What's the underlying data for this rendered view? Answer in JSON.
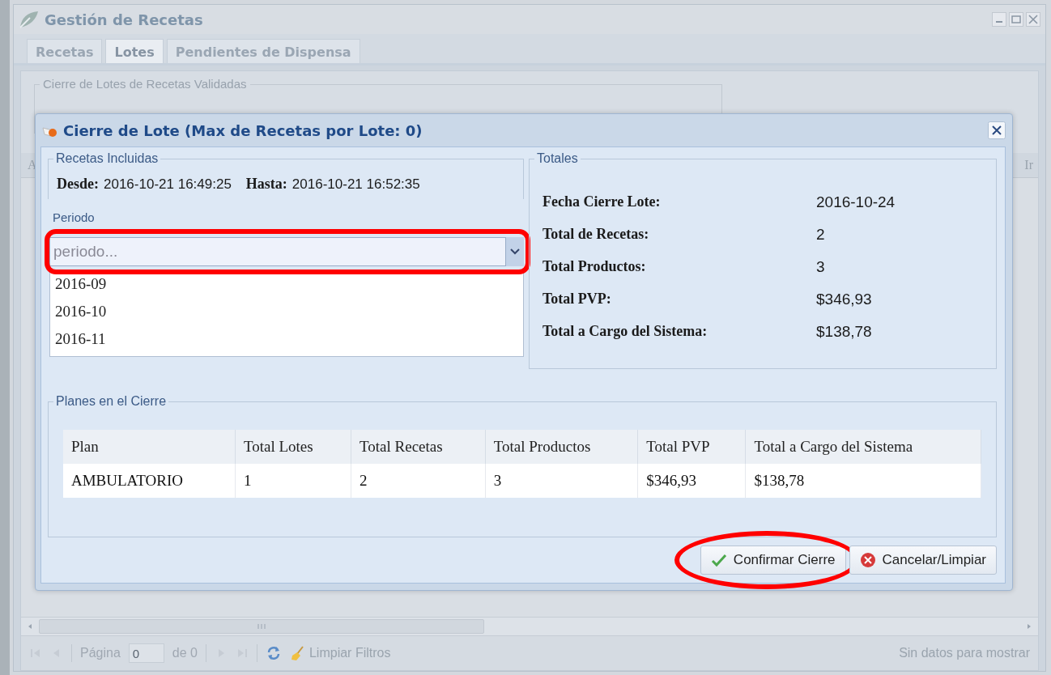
{
  "window": {
    "title": "Gestión de Recetas"
  },
  "tabs": [
    {
      "label": "Recetas",
      "selected": false
    },
    {
      "label": "Lotes",
      "selected": true
    },
    {
      "label": "Pendientes de Dispensa",
      "selected": false
    }
  ],
  "panel": {
    "legend": "Cierre de Lotes de Recetas Validadas"
  },
  "grid": {
    "columns": [
      "A",
      "Ir"
    ]
  },
  "dialog": {
    "title": "Cierre de Lote (Max de Recetas por Lote: 0)",
    "included": {
      "legend": "Recetas Incluidas",
      "fields": [
        {
          "label": "Desde:",
          "value": "2016-10-21 16:49:25"
        },
        {
          "label": "Hasta:",
          "value": "2016-10-21 16:52:35"
        }
      ]
    },
    "period": {
      "label": "Periodo",
      "placeholder": "periodo...",
      "expanded": true,
      "highlighted": true,
      "options": [
        "2016-09",
        "2016-10",
        "2016-11"
      ]
    },
    "totals": {
      "legend": "Totales",
      "rows": [
        {
          "label": "Fecha Cierre Lote:",
          "value": "2016-10-24"
        },
        {
          "label": "Total de Recetas:",
          "value": "2"
        },
        {
          "label": "Total Productos:",
          "value": "3"
        },
        {
          "label": "Total PVP:",
          "value": "$346,93"
        },
        {
          "label": "Total a Cargo del Sistema:",
          "value": "$138,78"
        }
      ]
    },
    "plans": {
      "legend": "Planes en el Cierre",
      "columns": [
        "Plan",
        "Total Lotes",
        "Total Recetas",
        "Total Productos",
        "Total PVP",
        "Total a Cargo del Sistema"
      ],
      "rows": [
        [
          "AMBULATORIO",
          "1",
          "2",
          "3",
          "$346,93",
          "$138,78"
        ]
      ]
    },
    "buttons": [
      {
        "label": "Confirmar Cierre",
        "kind": "confirm",
        "highlighted": true
      },
      {
        "label": "Cancelar/Limpiar",
        "kind": "cancel",
        "highlighted": false
      }
    ]
  },
  "pager": {
    "page_label": "Página",
    "page_value": "0",
    "of": "de 0",
    "clear_filters": "Limpiar Filtros",
    "status": "Sin datos para mostrar"
  }
}
